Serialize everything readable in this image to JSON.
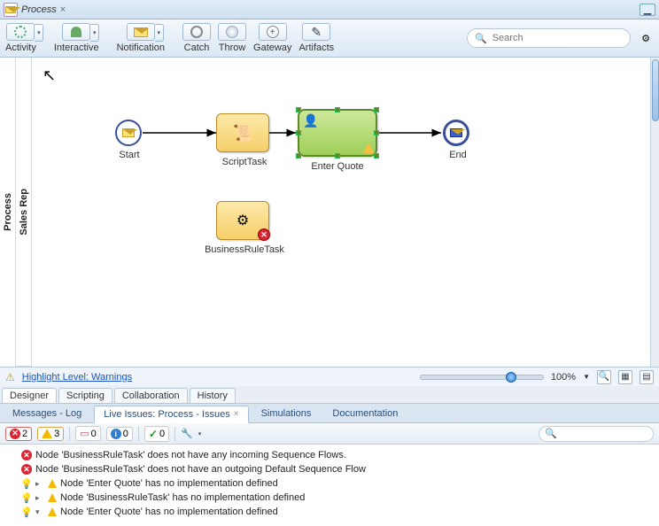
{
  "titlebar": {
    "title": "Process"
  },
  "toolbar": {
    "items": [
      {
        "label": "Activity"
      },
      {
        "label": "Interactive"
      },
      {
        "label": "Notification"
      },
      {
        "label": "Catch"
      },
      {
        "label": "Throw"
      },
      {
        "label": "Gateway"
      },
      {
        "label": "Artifacts"
      }
    ],
    "search_placeholder": "Search"
  },
  "pool": {
    "name": "Process"
  },
  "lane": {
    "name": "Sales Rep"
  },
  "nodes": {
    "start": "Start",
    "scriptTask": "ScriptTask",
    "enterQuote": "Enter Quote",
    "end": "End",
    "businessRuleTask": "BusinessRuleTask"
  },
  "statusbar": {
    "highlight_link": "Highlight Level: Warnings",
    "zoom": "100%"
  },
  "designer_tabs": [
    "Designer",
    "Scripting",
    "Collaboration",
    "History"
  ],
  "lower_tabs": [
    "Messages - Log",
    "Live Issues: Process - Issues",
    "Simulations",
    "Documentation"
  ],
  "issue_counts": {
    "errors": "2",
    "warnings": "3",
    "pink": "0",
    "info": "0",
    "ok": "0"
  },
  "issues": [
    {
      "level": 1,
      "kind": "error",
      "text": "Node 'BusinessRuleTask' does not have any incoming Sequence Flows."
    },
    {
      "level": 1,
      "kind": "error",
      "text": "Node 'BusinessRuleTask' does not have an outgoing Default Sequence Flow"
    },
    {
      "level": 1,
      "kind": "warn-bulb",
      "text": "Node 'Enter Quote' has no implementation defined"
    },
    {
      "level": 1,
      "kind": "warn-bulb",
      "text": "Node 'BusinessRuleTask' has no implementation defined"
    },
    {
      "level": 2,
      "kind": "warn",
      "text": "Node 'Enter Quote' has no implementation defined"
    }
  ]
}
